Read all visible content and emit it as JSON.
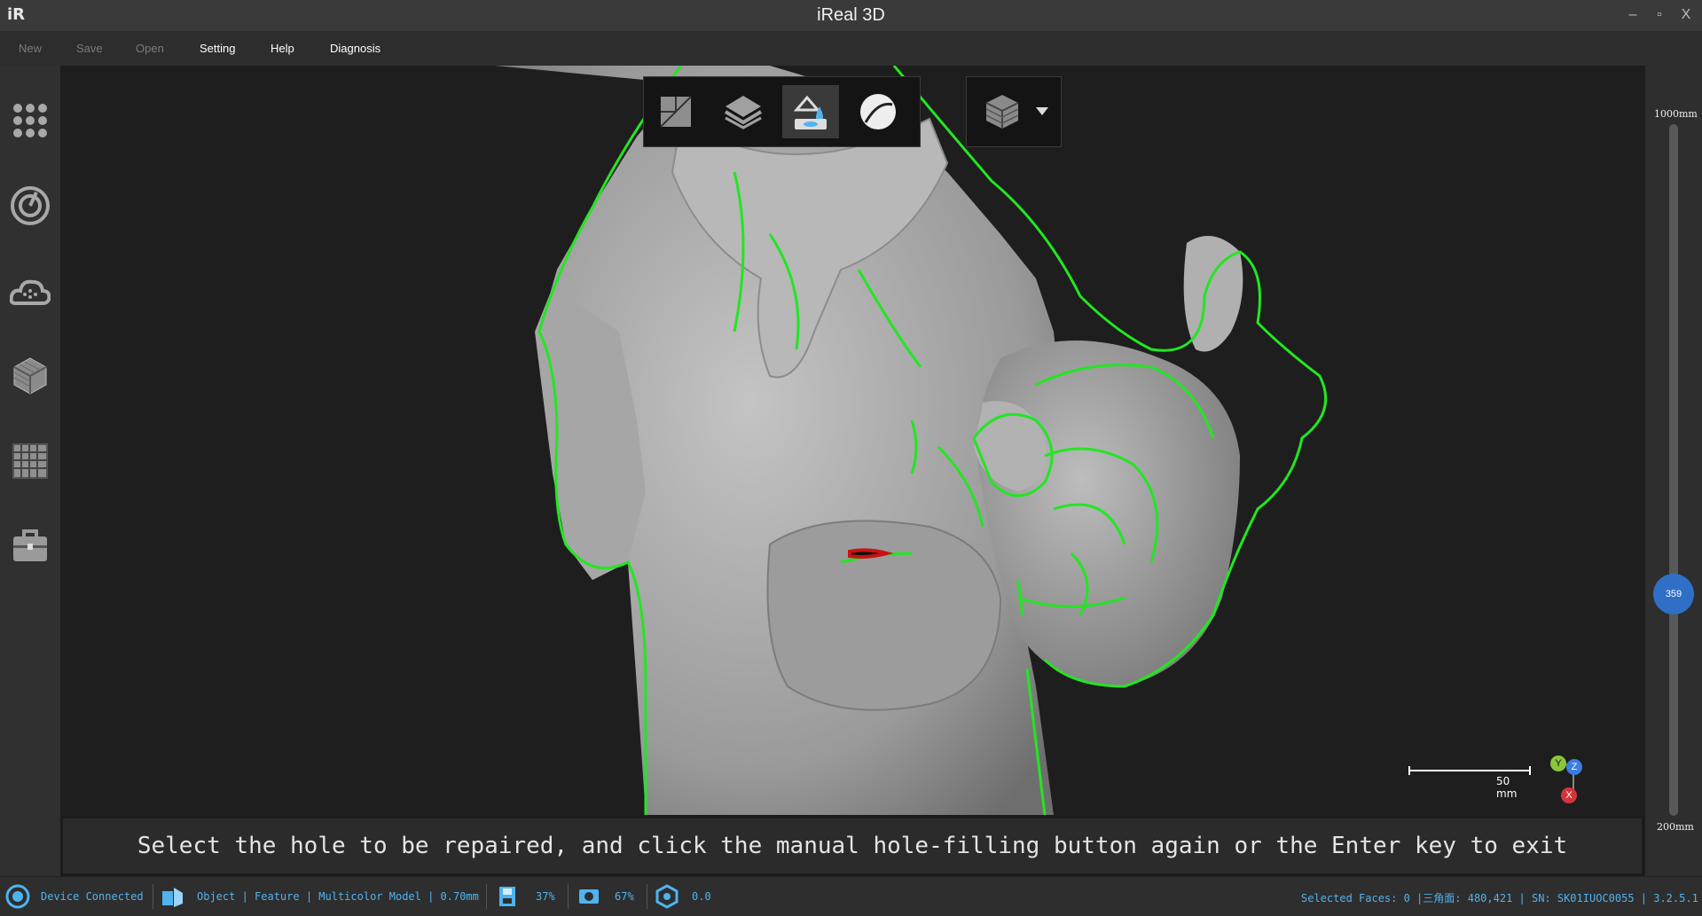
{
  "window": {
    "title": "iReal 3D",
    "logo": "iR",
    "minimize": "–",
    "restore": "▫",
    "close": "X"
  },
  "menu": [
    {
      "label": "New",
      "enabled": false
    },
    {
      "label": "Save",
      "enabled": false
    },
    {
      "label": "Open",
      "enabled": false
    },
    {
      "label": "Setting",
      "enabled": true
    },
    {
      "label": "Help",
      "enabled": true
    },
    {
      "label": "Diagnosis",
      "enabled": true
    }
  ],
  "sidebar_icons": [
    "dots-grid-icon",
    "scan-target-icon",
    "cloud-points-icon",
    "mesh-cube-icon",
    "grid-table-icon",
    "toolbox-icon"
  ],
  "toolbar": {
    "buttons": [
      "mesh-edit-icon",
      "layers-icon",
      "hole-fill-icon",
      "smooth-sphere-icon"
    ],
    "active": "hole-fill-icon",
    "view_button": "layered-cube-icon"
  },
  "slider": {
    "max_label": "1000mm",
    "min_label": "200mm",
    "value": "359",
    "value_fraction": 0.199
  },
  "scale_bar": {
    "label": "50 mm"
  },
  "axes": {
    "y": "Y",
    "z": "Z",
    "x": "X"
  },
  "hint": "Select the hole to be repaired, and click the manual hole-filling button again or the Enter key to exit",
  "status": {
    "device": "Device Connected",
    "mode": "Object | Feature | Multicolor Model | 0.70mm",
    "storage": "37%",
    "capture": "67%",
    "rotation": "0.0",
    "right": "Selected Faces: 0 |三角面: 480,421 | SN: SK01IUOC0055 | 3.2.5.1"
  },
  "colors": {
    "accent": "#4fb3f0",
    "outline": "#22e622",
    "selected_hole": "#cc1111",
    "knob": "#2f6fc6"
  }
}
